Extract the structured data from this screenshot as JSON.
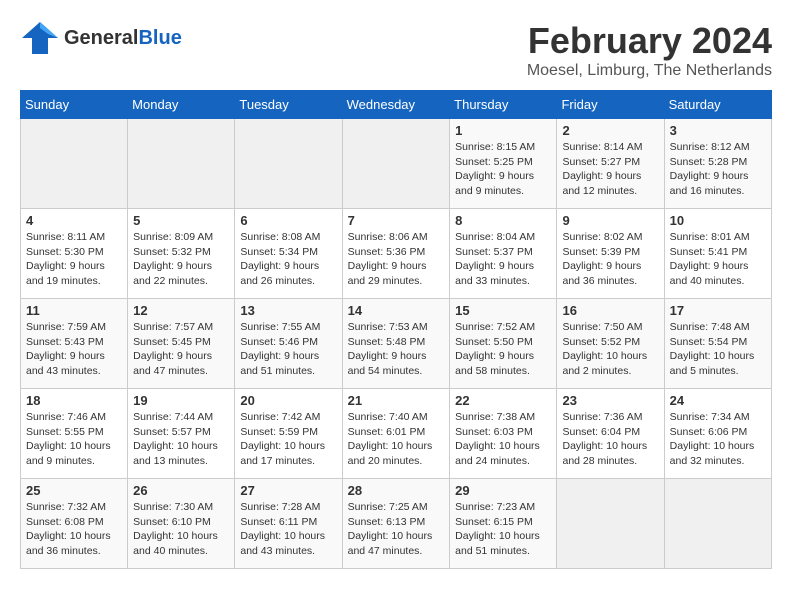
{
  "header": {
    "logo": {
      "general": "General",
      "blue": "Blue"
    },
    "title": "February 2024",
    "location": "Moesel, Limburg, The Netherlands"
  },
  "weekdays": [
    "Sunday",
    "Monday",
    "Tuesday",
    "Wednesday",
    "Thursday",
    "Friday",
    "Saturday"
  ],
  "weeks": [
    [
      {
        "day": "",
        "info": ""
      },
      {
        "day": "",
        "info": ""
      },
      {
        "day": "",
        "info": ""
      },
      {
        "day": "",
        "info": ""
      },
      {
        "day": "1",
        "info": "Sunrise: 8:15 AM\nSunset: 5:25 PM\nDaylight: 9 hours\nand 9 minutes."
      },
      {
        "day": "2",
        "info": "Sunrise: 8:14 AM\nSunset: 5:27 PM\nDaylight: 9 hours\nand 12 minutes."
      },
      {
        "day": "3",
        "info": "Sunrise: 8:12 AM\nSunset: 5:28 PM\nDaylight: 9 hours\nand 16 minutes."
      }
    ],
    [
      {
        "day": "4",
        "info": "Sunrise: 8:11 AM\nSunset: 5:30 PM\nDaylight: 9 hours\nand 19 minutes."
      },
      {
        "day": "5",
        "info": "Sunrise: 8:09 AM\nSunset: 5:32 PM\nDaylight: 9 hours\nand 22 minutes."
      },
      {
        "day": "6",
        "info": "Sunrise: 8:08 AM\nSunset: 5:34 PM\nDaylight: 9 hours\nand 26 minutes."
      },
      {
        "day": "7",
        "info": "Sunrise: 8:06 AM\nSunset: 5:36 PM\nDaylight: 9 hours\nand 29 minutes."
      },
      {
        "day": "8",
        "info": "Sunrise: 8:04 AM\nSunset: 5:37 PM\nDaylight: 9 hours\nand 33 minutes."
      },
      {
        "day": "9",
        "info": "Sunrise: 8:02 AM\nSunset: 5:39 PM\nDaylight: 9 hours\nand 36 minutes."
      },
      {
        "day": "10",
        "info": "Sunrise: 8:01 AM\nSunset: 5:41 PM\nDaylight: 9 hours\nand 40 minutes."
      }
    ],
    [
      {
        "day": "11",
        "info": "Sunrise: 7:59 AM\nSunset: 5:43 PM\nDaylight: 9 hours\nand 43 minutes."
      },
      {
        "day": "12",
        "info": "Sunrise: 7:57 AM\nSunset: 5:45 PM\nDaylight: 9 hours\nand 47 minutes."
      },
      {
        "day": "13",
        "info": "Sunrise: 7:55 AM\nSunset: 5:46 PM\nDaylight: 9 hours\nand 51 minutes."
      },
      {
        "day": "14",
        "info": "Sunrise: 7:53 AM\nSunset: 5:48 PM\nDaylight: 9 hours\nand 54 minutes."
      },
      {
        "day": "15",
        "info": "Sunrise: 7:52 AM\nSunset: 5:50 PM\nDaylight: 9 hours\nand 58 minutes."
      },
      {
        "day": "16",
        "info": "Sunrise: 7:50 AM\nSunset: 5:52 PM\nDaylight: 10 hours\nand 2 minutes."
      },
      {
        "day": "17",
        "info": "Sunrise: 7:48 AM\nSunset: 5:54 PM\nDaylight: 10 hours\nand 5 minutes."
      }
    ],
    [
      {
        "day": "18",
        "info": "Sunrise: 7:46 AM\nSunset: 5:55 PM\nDaylight: 10 hours\nand 9 minutes."
      },
      {
        "day": "19",
        "info": "Sunrise: 7:44 AM\nSunset: 5:57 PM\nDaylight: 10 hours\nand 13 minutes."
      },
      {
        "day": "20",
        "info": "Sunrise: 7:42 AM\nSunset: 5:59 PM\nDaylight: 10 hours\nand 17 minutes."
      },
      {
        "day": "21",
        "info": "Sunrise: 7:40 AM\nSunset: 6:01 PM\nDaylight: 10 hours\nand 20 minutes."
      },
      {
        "day": "22",
        "info": "Sunrise: 7:38 AM\nSunset: 6:03 PM\nDaylight: 10 hours\nand 24 minutes."
      },
      {
        "day": "23",
        "info": "Sunrise: 7:36 AM\nSunset: 6:04 PM\nDaylight: 10 hours\nand 28 minutes."
      },
      {
        "day": "24",
        "info": "Sunrise: 7:34 AM\nSunset: 6:06 PM\nDaylight: 10 hours\nand 32 minutes."
      }
    ],
    [
      {
        "day": "25",
        "info": "Sunrise: 7:32 AM\nSunset: 6:08 PM\nDaylight: 10 hours\nand 36 minutes."
      },
      {
        "day": "26",
        "info": "Sunrise: 7:30 AM\nSunset: 6:10 PM\nDaylight: 10 hours\nand 40 minutes."
      },
      {
        "day": "27",
        "info": "Sunrise: 7:28 AM\nSunset: 6:11 PM\nDaylight: 10 hours\nand 43 minutes."
      },
      {
        "day": "28",
        "info": "Sunrise: 7:25 AM\nSunset: 6:13 PM\nDaylight: 10 hours\nand 47 minutes."
      },
      {
        "day": "29",
        "info": "Sunrise: 7:23 AM\nSunset: 6:15 PM\nDaylight: 10 hours\nand 51 minutes."
      },
      {
        "day": "",
        "info": ""
      },
      {
        "day": "",
        "info": ""
      }
    ]
  ]
}
